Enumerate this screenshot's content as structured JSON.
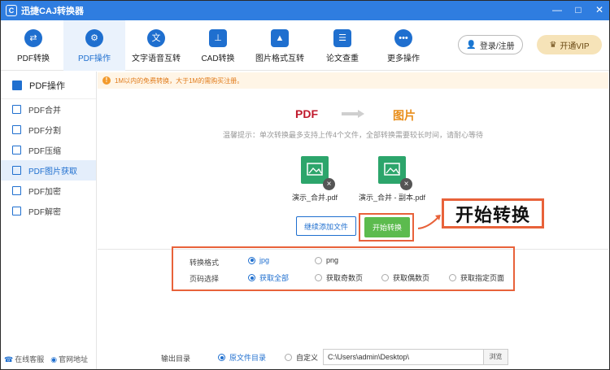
{
  "app": {
    "title": "迅捷CAJ转换器",
    "logo_letter": "C"
  },
  "window_controls": [
    "—",
    "□",
    "✕"
  ],
  "toolbar": {
    "tools": [
      {
        "label": "PDF转换",
        "icon": "swap-icon"
      },
      {
        "label": "PDF操作",
        "icon": "gear-icon",
        "active": true
      },
      {
        "label": "文字语音互转",
        "icon": "speech-icon"
      },
      {
        "label": "CAD转换",
        "icon": "cad-icon"
      },
      {
        "label": "图片格式互转",
        "icon": "image-icon"
      },
      {
        "label": "论文查重",
        "icon": "check-doc-icon"
      },
      {
        "label": "更多操作",
        "icon": "more-icon"
      }
    ],
    "login_label": "登录/注册",
    "vip_label": "开通VIP"
  },
  "sidebar": {
    "header": "PDF操作",
    "items": [
      {
        "label": "PDF合并"
      },
      {
        "label": "PDF分割"
      },
      {
        "label": "PDF压缩"
      },
      {
        "label": "PDF图片获取",
        "active": true
      },
      {
        "label": "PDF加密"
      },
      {
        "label": "PDF解密"
      }
    ],
    "footer": {
      "service": "在线客服",
      "website": "官网地址"
    }
  },
  "notice": "1M以内的免费转换，大于1M的需购买注册。",
  "conversion": {
    "from": "PDF",
    "to": "图片"
  },
  "tip": "温馨提示：单次转换最多支持上传4个文件，全部转换需要较长时间，请耐心等待",
  "files": [
    {
      "name": "演示_合并.pdf"
    },
    {
      "name": "演示_合并 - 副本.pdf"
    }
  ],
  "actions": {
    "add_files": "继续添加文件",
    "start": "开始转换"
  },
  "callout": "开始转换",
  "options": {
    "format_label": "转换格式",
    "formats": [
      {
        "label": "jpg",
        "selected": true
      },
      {
        "label": "png",
        "selected": false
      }
    ],
    "page_label": "页码选择",
    "pages": [
      {
        "label": "获取全部",
        "selected": true
      },
      {
        "label": "获取奇数页",
        "selected": false
      },
      {
        "label": "获取偶数页",
        "selected": false
      },
      {
        "label": "获取指定页面",
        "selected": false
      }
    ]
  },
  "output": {
    "label": "输出目录",
    "modes": [
      {
        "label": "原文件目录",
        "selected": true
      },
      {
        "label": "自定义",
        "selected": false
      }
    ],
    "path": "C:\\Users\\admin\\Desktop\\",
    "browse": "浏览"
  },
  "colors": {
    "primary": "#1f6fcf",
    "titlebar": "#2f7de0",
    "start": "#5cbb4e",
    "highlight": "#e8623a",
    "pdf": "#c0192c",
    "image": "#e98e1a"
  }
}
